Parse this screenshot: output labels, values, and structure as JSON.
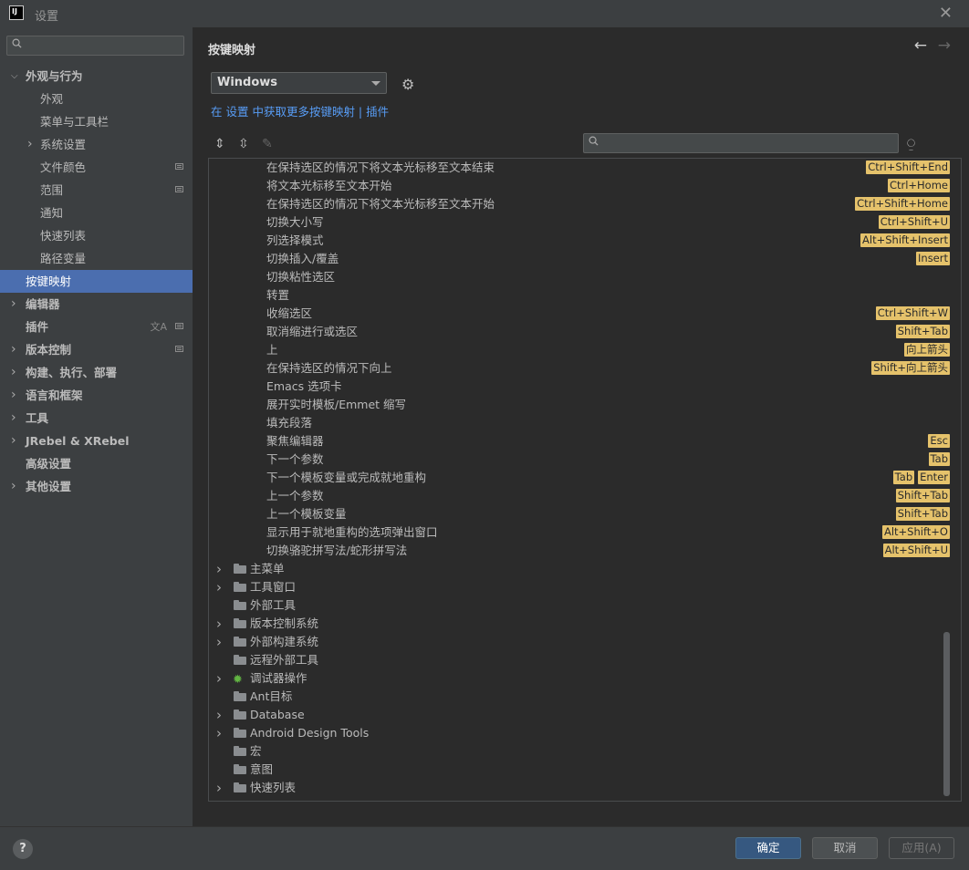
{
  "window": {
    "title": "设置",
    "logo": "IJ"
  },
  "sidebar": {
    "items": [
      {
        "label": "外观与行为",
        "bold": true,
        "expanded": true,
        "level": 0
      },
      {
        "label": "外观",
        "level": 1
      },
      {
        "label": "菜单与工具栏",
        "level": 1
      },
      {
        "label": "系统设置",
        "level": 1,
        "collapsed": true
      },
      {
        "label": "文件颜色",
        "level": 1,
        "indicator": true
      },
      {
        "label": "范围",
        "level": 1,
        "indicator": true
      },
      {
        "label": "通知",
        "level": 1
      },
      {
        "label": "快速列表",
        "level": 1
      },
      {
        "label": "路径变量",
        "level": 1
      },
      {
        "label": "按键映射",
        "level": 0,
        "active": true
      },
      {
        "label": "编辑器",
        "bold": true,
        "collapsed": true,
        "level": 0
      },
      {
        "label": "插件",
        "bold": true,
        "level": 0,
        "indicator": true,
        "translate": true
      },
      {
        "label": "版本控制",
        "bold": true,
        "collapsed": true,
        "level": 0,
        "indicator": true
      },
      {
        "label": "构建、执行、部署",
        "bold": true,
        "collapsed": true,
        "level": 0
      },
      {
        "label": "语言和框架",
        "bold": true,
        "collapsed": true,
        "level": 0
      },
      {
        "label": "工具",
        "bold": true,
        "collapsed": true,
        "level": 0
      },
      {
        "label": "JRebel & XRebel",
        "bold": true,
        "collapsed": true,
        "level": 0
      },
      {
        "label": "高级设置",
        "bold": true,
        "level": 0
      },
      {
        "label": "其他设置",
        "bold": true,
        "collapsed": true,
        "level": 0
      }
    ]
  },
  "main": {
    "title": "按键映射",
    "keymap_value": "Windows",
    "plugin_link": "在 设置 中获取更多按键映射 | 插件"
  },
  "actions": [
    {
      "label": "在保持选区的情况下将文本光标移至文本结束",
      "keys": [
        "Ctrl+Shift+End"
      ]
    },
    {
      "label": "将文本光标移至文本开始",
      "keys": [
        "Ctrl+Home"
      ]
    },
    {
      "label": "在保持选区的情况下将文本光标移至文本开始",
      "keys": [
        "Ctrl+Shift+Home"
      ]
    },
    {
      "label": "切换大小写",
      "keys": [
        "Ctrl+Shift+U"
      ]
    },
    {
      "label": "列选择模式",
      "keys": [
        "Alt+Shift+Insert"
      ]
    },
    {
      "label": "切换插入/覆盖",
      "keys": [
        "Insert"
      ]
    },
    {
      "label": "切换粘性选区",
      "keys": []
    },
    {
      "label": "转置",
      "keys": []
    },
    {
      "label": "收缩选区",
      "keys": [
        "Ctrl+Shift+W"
      ]
    },
    {
      "label": "取消缩进行或选区",
      "keys": [
        "Shift+Tab"
      ]
    },
    {
      "label": "上",
      "keys": [
        "向上箭头"
      ]
    },
    {
      "label": "在保持选区的情况下向上",
      "keys": [
        "Shift+向上箭头"
      ]
    },
    {
      "label": "Emacs 选项卡",
      "keys": []
    },
    {
      "label": "展开实时模板/Emmet 缩写",
      "keys": []
    },
    {
      "label": "填充段落",
      "keys": []
    },
    {
      "label": "聚焦编辑器",
      "keys": [
        "Esc"
      ]
    },
    {
      "label": "下一个参数",
      "keys": [
        "Tab"
      ]
    },
    {
      "label": "下一个模板变量或完成就地重构",
      "keys": [
        "Tab",
        "Enter"
      ]
    },
    {
      "label": "上一个参数",
      "keys": [
        "Shift+Tab"
      ]
    },
    {
      "label": "上一个模板变量",
      "keys": [
        "Shift+Tab"
      ]
    },
    {
      "label": "显示用于就地重构的选项弹出窗口",
      "keys": [
        "Alt+Shift+O"
      ]
    },
    {
      "label": "切换骆驼拼写法/蛇形拼写法",
      "keys": [
        "Alt+Shift+U"
      ]
    }
  ],
  "groups": [
    {
      "label": "主菜单",
      "expandable": true,
      "icon": "folder-icon"
    },
    {
      "label": "工具窗口",
      "expandable": true,
      "icon": "folder-icon"
    },
    {
      "label": "外部工具",
      "expandable": false,
      "icon": "folder-icon"
    },
    {
      "label": "版本控制系统",
      "expandable": true,
      "icon": "folder-icon"
    },
    {
      "label": "外部构建系统",
      "expandable": true,
      "icon": "folder-icon"
    },
    {
      "label": "远程外部工具",
      "expandable": false,
      "icon": "folder-icon"
    },
    {
      "label": "调试器操作",
      "expandable": true,
      "icon": "bug-icon"
    },
    {
      "label": "Ant目标",
      "expandable": false,
      "icon": "folder-icon"
    },
    {
      "label": "Database",
      "expandable": true,
      "icon": "folder-icon"
    },
    {
      "label": "Android Design Tools",
      "expandable": true,
      "icon": "folder-icon"
    },
    {
      "label": "宏",
      "expandable": false,
      "icon": "folder-icon"
    },
    {
      "label": "意图",
      "expandable": false,
      "icon": "folder-icon"
    },
    {
      "label": "快速列表",
      "expandable": true,
      "icon": "folder-icon"
    }
  ],
  "footer": {
    "help": "?",
    "ok": "确定",
    "cancel": "取消",
    "apply": "应用(A)"
  },
  "colors": {
    "accent": "#4b6eaf",
    "shortcut_badge": "#e5c26b",
    "link": "#589df6",
    "ok_button": "#365880"
  }
}
